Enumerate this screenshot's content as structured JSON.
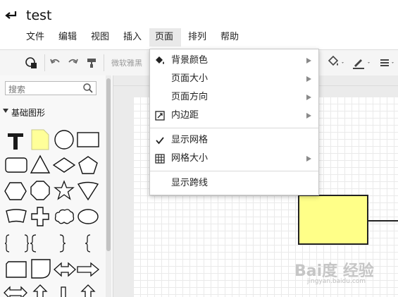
{
  "app": {
    "title": "test"
  },
  "menubar": {
    "items": [
      {
        "label": "文件"
      },
      {
        "label": "编辑"
      },
      {
        "label": "视图"
      },
      {
        "label": "插入"
      },
      {
        "label": "页面"
      },
      {
        "label": "排列"
      },
      {
        "label": "帮助"
      }
    ],
    "active": "页面"
  },
  "toolbar": {
    "font_name": "微软雅黑",
    "icons": [
      "shape-style-icon",
      "undo-icon",
      "redo-icon",
      "format-painter-icon",
      "fill-color-icon",
      "line-color-icon",
      "line-style-icon"
    ]
  },
  "sidebar": {
    "search_placeholder": "搜索",
    "palette_title": "基础图形"
  },
  "page_menu": {
    "items": [
      {
        "label": "背景颜色",
        "icon": "paint-bucket-icon",
        "submenu": true
      },
      {
        "label": "页面大小",
        "icon": "",
        "submenu": true
      },
      {
        "label": "页面方向",
        "icon": "",
        "submenu": true
      },
      {
        "label": "内边距",
        "icon": "padding-icon",
        "submenu": true
      },
      {
        "label": "显示网格",
        "icon": "check-icon",
        "submenu": false,
        "checked": true
      },
      {
        "label": "网格大小",
        "icon": "grid-icon",
        "submenu": true
      },
      {
        "label": "显示跨线",
        "icon": "",
        "submenu": false
      }
    ]
  },
  "watermark": {
    "main": "Bai度 经验",
    "sub": "jingyan.baidu.com"
  },
  "colors": {
    "shape_fill": "#ffff88",
    "note_fill": "#ffff99",
    "menu_highlight": "#e9e9e9"
  }
}
